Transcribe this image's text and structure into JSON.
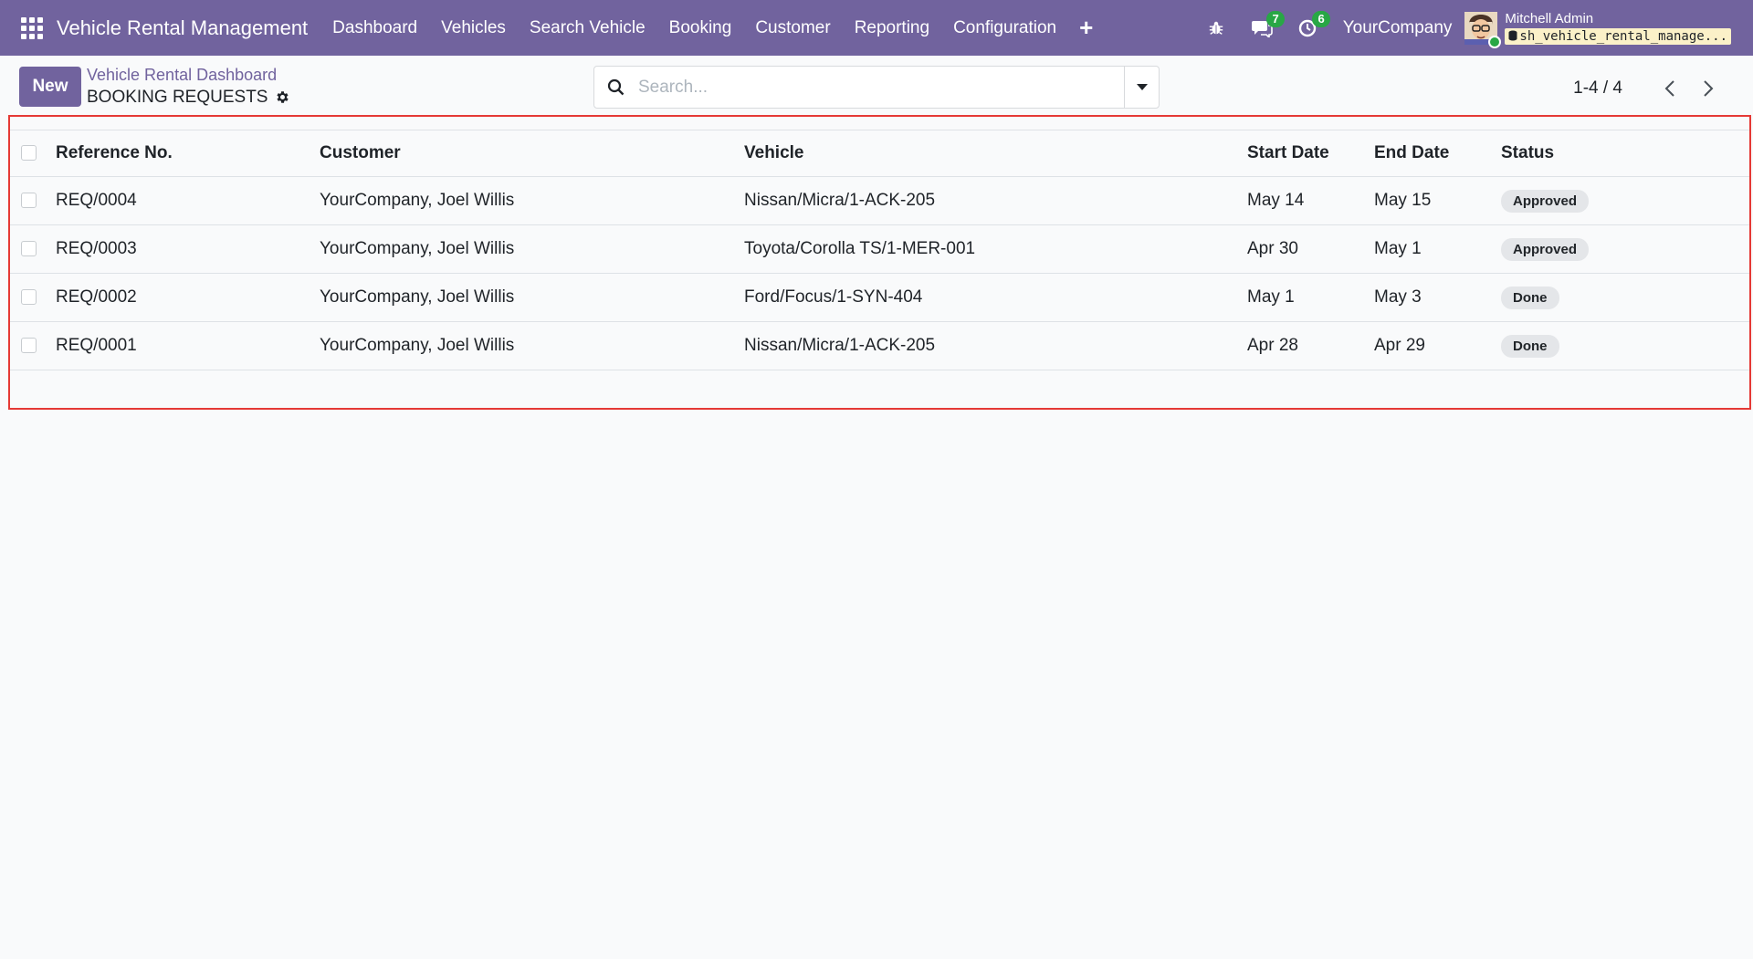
{
  "navbar": {
    "app_title": "Vehicle Rental Management",
    "menu": [
      "Dashboard",
      "Vehicles",
      "Search Vehicle",
      "Booking",
      "Customer",
      "Reporting",
      "Configuration"
    ],
    "messages_count": "7",
    "activities_count": "6",
    "company": "YourCompany",
    "user_name": "Mitchell Admin",
    "database": "sh_vehicle_rental_manage..."
  },
  "control": {
    "new_label": "New",
    "breadcrumb_parent": "Vehicle Rental Dashboard",
    "breadcrumb_current": "BOOKING REQUESTS",
    "search_placeholder": "Search...",
    "pager": "1-4 / 4"
  },
  "table": {
    "headers": {
      "reference": "Reference No.",
      "customer": "Customer",
      "vehicle": "Vehicle",
      "start_date": "Start Date",
      "end_date": "End Date",
      "status": "Status"
    },
    "rows": [
      {
        "reference": "REQ/0004",
        "customer": "YourCompany, Joel Willis",
        "vehicle": "Nissan/Micra/1-ACK-205",
        "start_date": "May 14",
        "end_date": "May 15",
        "status": "Approved"
      },
      {
        "reference": "REQ/0003",
        "customer": "YourCompany, Joel Willis",
        "vehicle": "Toyota/Corolla TS/1-MER-001",
        "start_date": "Apr 30",
        "end_date": "May 1",
        "status": "Approved"
      },
      {
        "reference": "REQ/0002",
        "customer": "YourCompany, Joel Willis",
        "vehicle": "Ford/Focus/1-SYN-404",
        "start_date": "May 1",
        "end_date": "May 3",
        "status": "Done"
      },
      {
        "reference": "REQ/0001",
        "customer": "YourCompany, Joel Willis",
        "vehicle": "Nissan/Micra/1-ACK-205",
        "start_date": "Apr 28",
        "end_date": "Apr 29",
        "status": "Done"
      }
    ]
  },
  "icons": {
    "apps": "apps-grid-icon",
    "debug": "bug-icon",
    "messages": "chat-icon",
    "activities": "clock-icon",
    "gear": "gear-icon",
    "search": "search-icon",
    "dropdown": "caret-down-icon",
    "prev": "chevron-left-icon",
    "next": "chevron-right-icon"
  },
  "colors": {
    "brand": "#71639e",
    "badge": "#28a745",
    "highlight_border": "#e53935"
  }
}
